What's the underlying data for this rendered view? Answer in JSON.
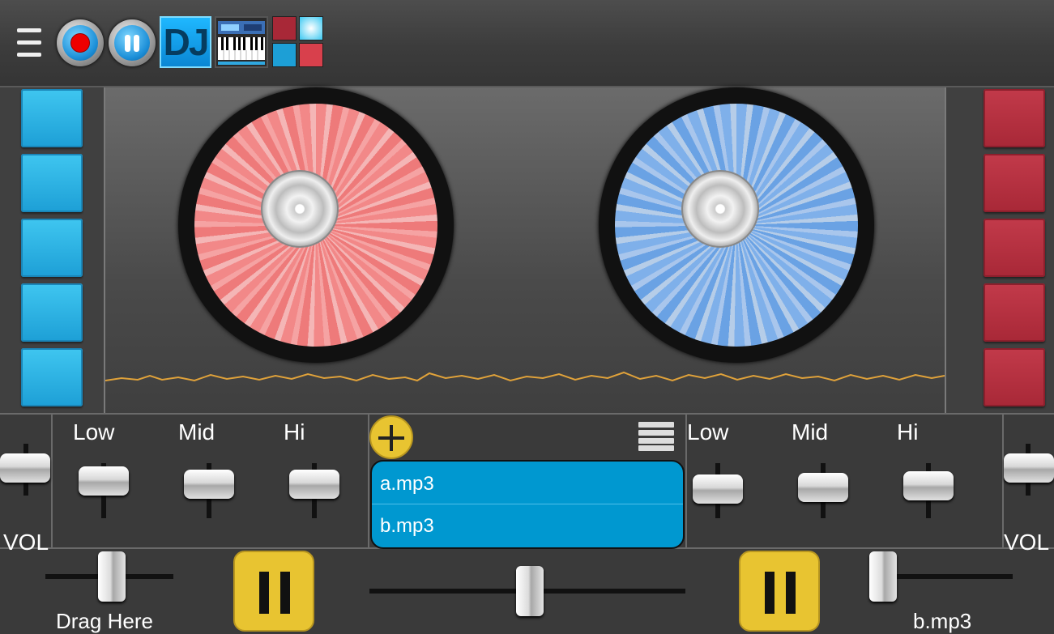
{
  "toolbar": {
    "dj_label": "DJ"
  },
  "mixer": {
    "left": {
      "low": "Low",
      "mid": "Mid",
      "hi": "Hi",
      "vol": "VOL"
    },
    "right": {
      "low": "Low",
      "mid": "Mid",
      "hi": "Hi",
      "vol": "VOL"
    }
  },
  "playlist": {
    "items": [
      "a.mp3",
      "b.mp3"
    ]
  },
  "bottom": {
    "left_track": "Drag Here",
    "right_track": "b.mp3"
  },
  "colors": {
    "accent_blue": "#0098d0",
    "pad_blue": "#1d9fd6",
    "pad_red": "#a82837",
    "button_yellow": "#e8c431",
    "waveform": "#e0a23a"
  }
}
